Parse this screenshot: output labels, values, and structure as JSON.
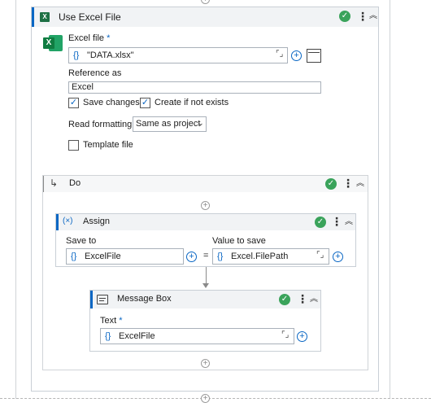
{
  "use_excel": {
    "title": "Use Excel File",
    "excel_file_label": "Excel file",
    "required_star": "*",
    "excel_file_value": "\"DATA.xlsx\"",
    "curly": "{}",
    "reference_label": "Reference as",
    "reference_value": "Excel",
    "save_changes_label": "Save changes",
    "create_if_not_exists_label": "Create if not exists",
    "save_changes_checked": true,
    "create_if_not_exists_checked": true,
    "read_formatting_label": "Read formatting",
    "read_formatting_value": "Same as project",
    "template_file_label": "Template file",
    "template_file_checked": false
  },
  "do": {
    "title": "Do"
  },
  "assign": {
    "title": "Assign",
    "icon_text": "(×)",
    "save_to_label": "Save to",
    "save_to_value": "ExcelFile",
    "equals": "=",
    "value_label": "Value to save",
    "value_value": "Excel.FilePath"
  },
  "message_box": {
    "title": "Message Box",
    "text_label": "Text",
    "text_value": "ExcelFile"
  },
  "colors": {
    "accent": "#0a67c4",
    "success": "#3aa35b",
    "excel_green": "#1e7145"
  },
  "icons": {
    "excel": "excel-icon",
    "check": "check-circle-icon",
    "more": "kebab-icon",
    "collapse": "chevron-double-up-icon",
    "expand": "expand-icon",
    "add": "plus-circle-icon",
    "folder": "folder-icon",
    "do_arrow": "arrow-down-right-icon",
    "message": "message-box-icon"
  }
}
